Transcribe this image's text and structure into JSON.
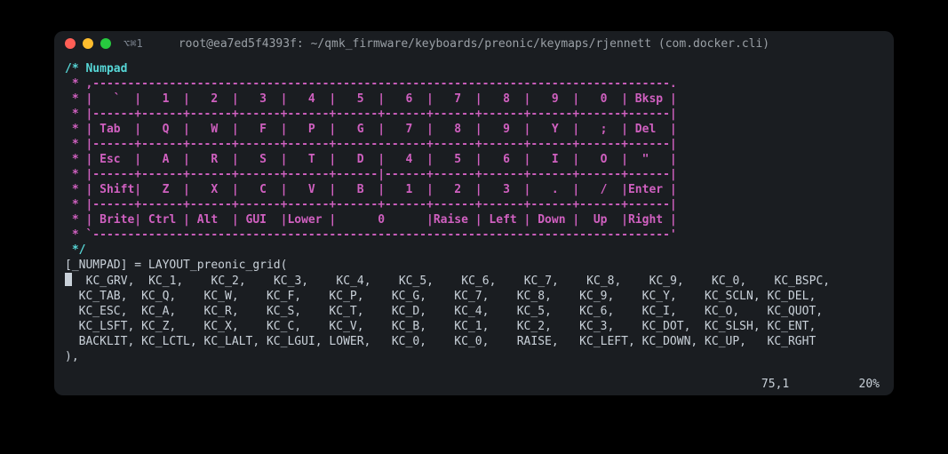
{
  "titlebar": {
    "extra": "⌥⌘1",
    "title": "root@ea7ed5f4393f: ~/qmk_firmware/keyboards/preonic/keymaps/rjennett (com.docker.cli)"
  },
  "comment": {
    "header": "/* Numpad",
    "border_top": " * ,-----------------------------------------------------------------------------------.",
    "row1": " * |   `  |   1  |   2  |   3  |   4  |   5  |   6  |   7  |   8  |   9  |   0  | Bksp |",
    "sep1": " * |------+------+------+------+------+------+------+------+------+------+------+------|",
    "row2": " * | Tab  |   Q  |   W  |   F  |   P  |   G  |   7  |   8  |   9  |   Y  |   ;  | Del  |",
    "sep2": " * |------+------+------+------+------+-------------+------+------+------+------+------|",
    "row3": " * | Esc  |   A  |   R  |   S  |   T  |   D  |   4  |   5  |   6  |   I  |   O  |  \"   |",
    "sep3": " * |------+------+------+------+------+------|------+------+------+------+------+------|",
    "row4": " * | Shift|   Z  |   X  |   C  |   V  |   B  |   1  |   2  |   3  |   .  |   /  |Enter |",
    "sep4": " * |------+------+------+------+------+------+------+------+------+------+------+------|",
    "row5": " * | Brite| Ctrl | Alt  | GUI  |Lower |      0      |Raise | Left | Down |  Up  |Right |",
    "border_bot": " * `-----------------------------------------------------------------------------------'",
    "footer": " */"
  },
  "code": {
    "decl": "[_NUMPAD] = LAYOUT_preonic_grid(",
    "rows": [
      "  KC_GRV,  KC_1,    KC_2,    KC_3,    KC_4,    KC_5,    KC_6,    KC_7,    KC_8,    KC_9,    KC_0,    KC_BSPC,",
      "  KC_TAB,  KC_Q,    KC_W,    KC_F,    KC_P,    KC_G,    KC_7,    KC_8,    KC_9,    KC_Y,    KC_SCLN, KC_DEL,",
      "  KC_ESC,  KC_A,    KC_R,    KC_S,    KC_T,    KC_D,    KC_4,    KC_5,    KC_6,    KC_I,    KC_O,    KC_QUOT,",
      "  KC_LSFT, KC_Z,    KC_X,    KC_C,    KC_V,    KC_B,    KC_1,    KC_2,    KC_3,    KC_DOT,  KC_SLSH, KC_ENT,",
      "  BACKLIT, KC_LCTL, KC_LALT, KC_LGUI, LOWER,   KC_0,    KC_0,    RAISE,   KC_LEFT, KC_DOWN, KC_UP,   KC_RGHT"
    ],
    "close": "),"
  },
  "status": {
    "pos": "75,1",
    "pct": "20%"
  }
}
